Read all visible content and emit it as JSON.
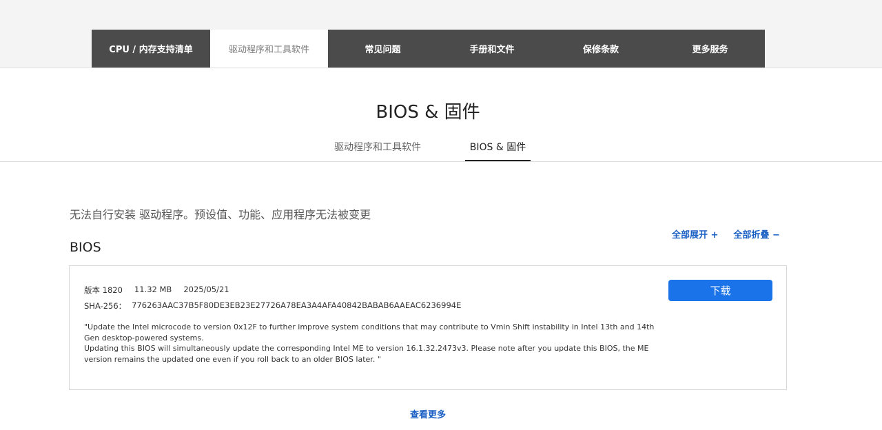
{
  "main_nav": {
    "items": [
      {
        "label": "CPU / 内存支持清单"
      },
      {
        "label": "驱动程序和工具软件"
      },
      {
        "label": "常见问题"
      },
      {
        "label": "手册和文件"
      },
      {
        "label": "保修条款"
      },
      {
        "label": "更多服务"
      }
    ],
    "active_index": 1
  },
  "page_title": "BIOS & 固件",
  "sub_tabs": {
    "items": [
      {
        "label": "驱动程序和工具软件"
      },
      {
        "label": "BIOS & 固件"
      }
    ],
    "active_index": 1
  },
  "notice": "无法自行安装 驱动程序。预设值、功能、应用程序无法被变更",
  "controls": {
    "expand_all": "全部展开 +",
    "collapse_all": "全部折叠 −"
  },
  "section_title": "BIOS",
  "bios_item": {
    "version": "版本 1820",
    "size": "11.32 MB",
    "date": "2025/05/21",
    "sha_label": "SHA-256：",
    "sha_value": "776263AAC37B5F80DE3EB23E27726A78EA3A4AFA40842BABAB6AAEAC6236994E",
    "description_lines": [
      "\"Update the Intel microcode to version 0x12F to further improve system conditions that may contribute to Vmin Shift instability in Intel 13th and 14th Gen desktop-powered systems.",
      "Updating this BIOS will simultaneously update the corresponding Intel ME to version 16.1.32.2473v3. Please note after you update this BIOS, the ME version remains the updated one even if you roll back to an older BIOS later. \""
    ],
    "download_label": "下载"
  },
  "view_more": "查看更多",
  "colors": {
    "nav_bg": "#4b4b4b",
    "accent_blue": "#1a73e8",
    "link_blue": "#1a5fc4"
  }
}
